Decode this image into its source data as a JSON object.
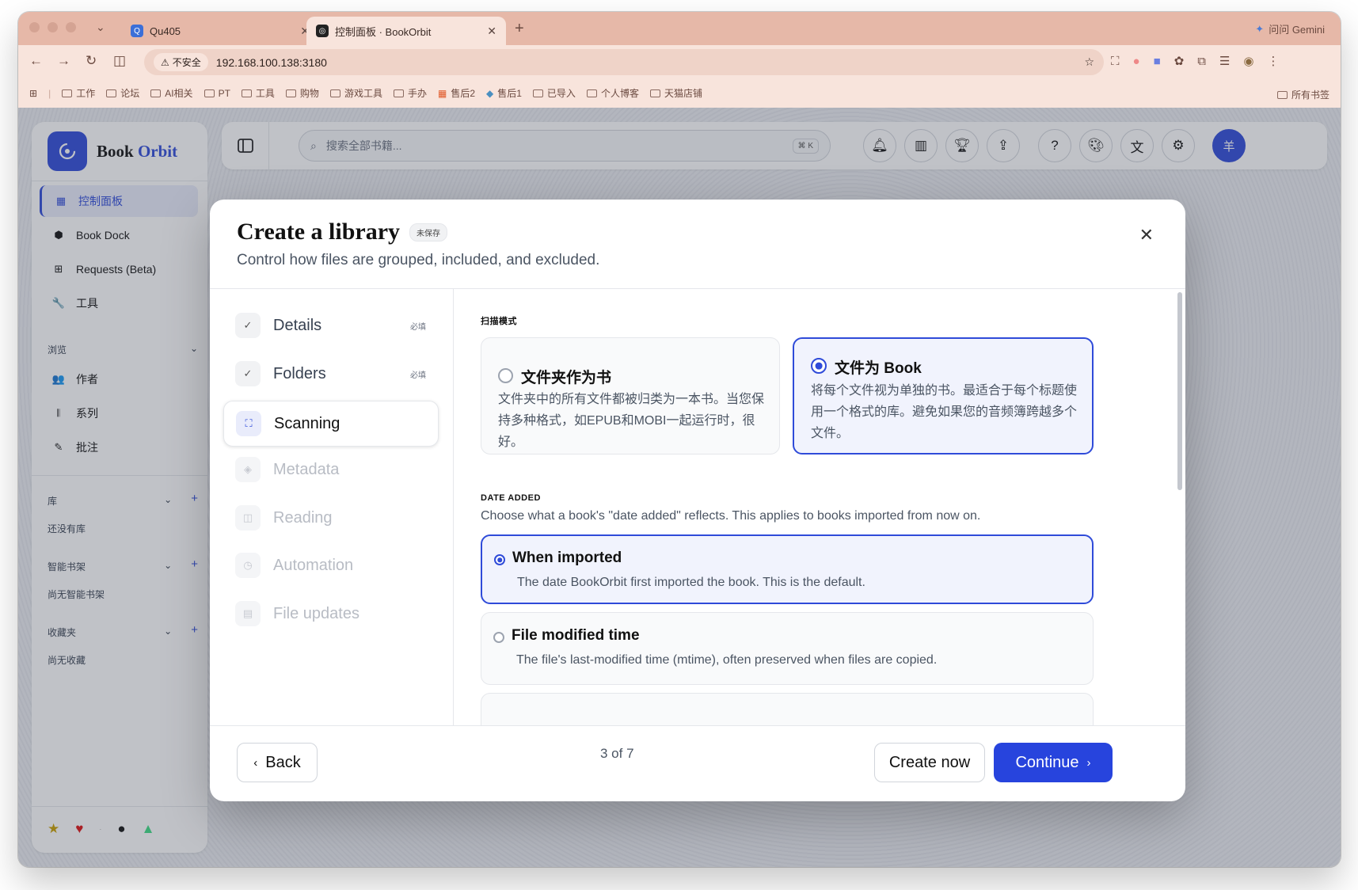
{
  "browser": {
    "tabs": [
      {
        "title": "Qu405",
        "icon": "qu-icon"
      },
      {
        "title": "控制面板 · BookOrbit",
        "icon": "bookorbit-icon"
      }
    ],
    "gemini_label": "问问 Gemini",
    "insecure_label": "不安全",
    "url": "192.168.100.138:3180",
    "bookmarks": [
      "工作",
      "论坛",
      "AI相关",
      "PT",
      "工具",
      "购物",
      "游戏工具",
      "手办",
      "售后2",
      "售后1",
      "已导入",
      "个人博客",
      "天猫店铺"
    ],
    "all_bookmarks": "所有书签"
  },
  "sidebar": {
    "brand_book": "Book",
    "brand_orbit": "Orbit",
    "nav": [
      {
        "label": "控制面板",
        "icon": "grid-icon"
      },
      {
        "label": "Book Dock",
        "icon": "box-icon"
      },
      {
        "label": "Requests (Beta)",
        "icon": "request-icon"
      },
      {
        "label": "工具",
        "icon": "wrench-icon"
      }
    ],
    "browse_header": "浏览",
    "browse": [
      {
        "label": "作者",
        "icon": "users-icon"
      },
      {
        "label": "系列",
        "icon": "library-icon"
      },
      {
        "label": "批注",
        "icon": "highlighter-icon"
      }
    ],
    "library_header": "库",
    "library_empty": "还没有库",
    "smart_header": "智能书架",
    "smart_empty": "尚无智能书架",
    "fav_header": "收藏夹",
    "fav_empty": "尚无收藏"
  },
  "topbar": {
    "search_placeholder": "搜索全部书籍...",
    "shortcut": "⌘ K",
    "avatar_initial": "羊"
  },
  "modal": {
    "title": "Create a library",
    "badge": "未保存",
    "subtitle": "Control how files are grouped, included, and excluded.",
    "steps": [
      {
        "label": "Details",
        "state": "done",
        "required": "必填"
      },
      {
        "label": "Folders",
        "state": "done",
        "required": "必填"
      },
      {
        "label": "Scanning",
        "state": "current",
        "required": ""
      },
      {
        "label": "Metadata",
        "state": "todo",
        "required": ""
      },
      {
        "label": "Reading",
        "state": "todo",
        "required": ""
      },
      {
        "label": "Automation",
        "state": "todo",
        "required": ""
      },
      {
        "label": "File updates",
        "state": "todo",
        "required": ""
      }
    ],
    "scan_mode_label": "扫描模式",
    "scan_options": [
      {
        "title": "文件夹作为书",
        "desc": "文件夹中的所有文件都被归类为一本书。当您保持多种格式，如EPUB和MOBI一起运行时，很好。",
        "selected": false
      },
      {
        "title": "文件为 Book",
        "desc": "将每个文件视为单独的书。最适合于每个标题使用一个格式的库。避免如果您的音频簿跨越多个文件。",
        "selected": true
      }
    ],
    "date_label": "DATE ADDED",
    "date_note": "Choose what a book's \"date added\" reflects. This applies to books imported from now on.",
    "date_options": [
      {
        "title": "When imported",
        "desc": "The date BookOrbit first imported the book. This is the default.",
        "selected": true
      },
      {
        "title": "File modified time",
        "desc": "The file's last-modified time (mtime), often preserved when files are copied.",
        "selected": false
      }
    ],
    "back_label": "Back",
    "pager": "3 of 7",
    "create_label": "Create now",
    "continue_label": "Continue"
  }
}
